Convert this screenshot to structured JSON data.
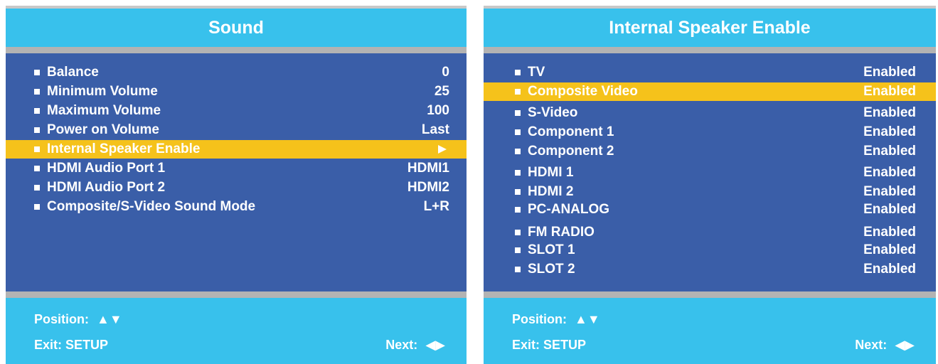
{
  "sound_panel": {
    "title": "Sound",
    "items": [
      {
        "label": "Balance",
        "value": "0"
      },
      {
        "label": "Minimum Volume",
        "value": "25"
      },
      {
        "label": "Maximum Volume",
        "value": "100"
      },
      {
        "label": "Power on Volume",
        "value": "Last"
      },
      {
        "label": "Internal Speaker Enable",
        "value": "",
        "selected": true
      },
      {
        "label": "HDMI Audio Port 1",
        "value": "HDMI1"
      },
      {
        "label": "HDMI Audio Port 2",
        "value": "HDMI2"
      },
      {
        "label": "Composite/S-Video Sound Mode",
        "value": "L+R"
      }
    ],
    "footer": {
      "position_label": "Position:",
      "position_glyph": "▲▼",
      "exit_label": "Exit: SETUP",
      "next_label": "Next:",
      "next_glyph": "◀▶"
    }
  },
  "speaker_panel": {
    "title": "Internal Speaker Enable",
    "items": [
      {
        "label": "TV",
        "value": "Enabled"
      },
      {
        "label": "Composite Video",
        "value": "Enabled",
        "selected": true
      },
      {
        "label": "S-Video",
        "value": "Enabled"
      },
      {
        "label": "Component 1",
        "value": "Enabled"
      },
      {
        "label": "Component 2",
        "value": "Enabled"
      },
      {
        "label": "HDMI 1",
        "value": "Enabled"
      },
      {
        "label": "HDMI 2",
        "value": "Enabled"
      },
      {
        "label": "PC-ANALOG",
        "value": "Enabled"
      },
      {
        "label": "FM RADIO",
        "value": "Enabled"
      },
      {
        "label": "SLOT 1",
        "value": "Enabled"
      },
      {
        "label": "SLOT 2",
        "value": "Enabled"
      }
    ],
    "footer": {
      "position_label": "Position:",
      "position_glyph": "▲▼",
      "exit_label": "Exit: SETUP",
      "next_label": "Next:",
      "next_glyph": "◀▶"
    }
  },
  "colors": {
    "title_bar": "#38c1ec",
    "menu_body": "#3a5ea8",
    "highlight": "#f5c21b",
    "separator": "#b3b3b3",
    "text": "#ffffff"
  }
}
